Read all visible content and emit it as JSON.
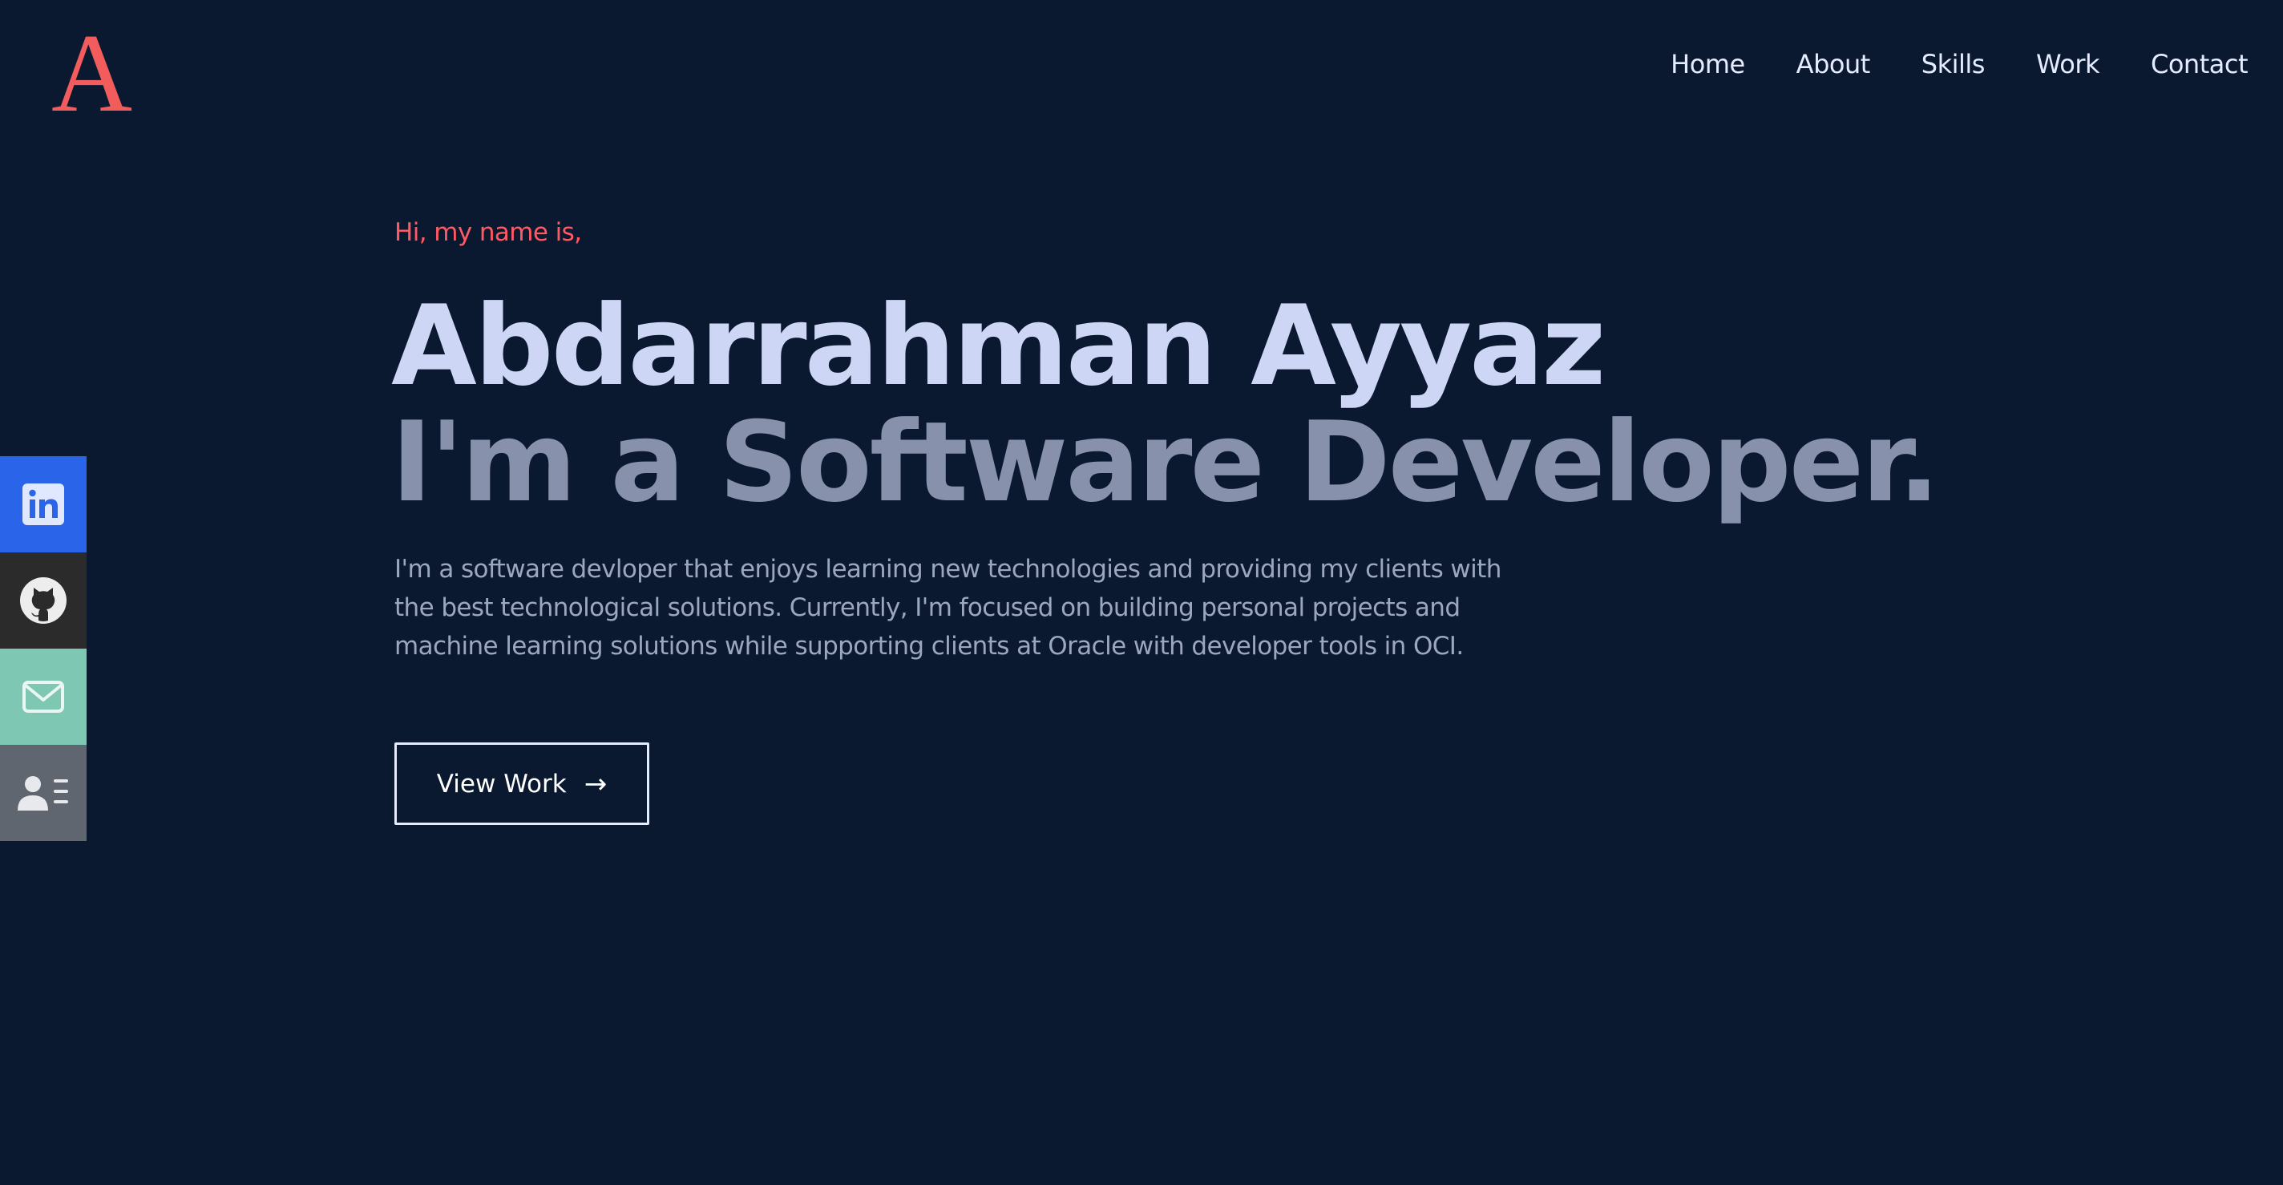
{
  "logo": {
    "text": "A"
  },
  "nav": {
    "items": [
      {
        "label": "Home"
      },
      {
        "label": "About"
      },
      {
        "label": "Skills"
      },
      {
        "label": "Work"
      },
      {
        "label": "Contact"
      }
    ]
  },
  "hero": {
    "greeting": "Hi, my name is,",
    "name": "Abdarrahman Ayyaz",
    "role": "I'm a Software Developer.",
    "description": "I'm a software devloper that enjoys learning new technologies and providing my clients with the best technological solutions. Currently, I'm focused on building personal projects and machine learning solutions while supporting clients at Oracle with developer tools in OCI.",
    "cta_label": "View Work",
    "cta_icon": "arrow-right-icon"
  },
  "social": {
    "items": [
      {
        "icon": "linkedin-icon",
        "color": "#2a64e8"
      },
      {
        "icon": "github-icon",
        "color": "#2b2b2b"
      },
      {
        "icon": "mail-icon",
        "color": "#7dc7b3"
      },
      {
        "icon": "contact-card-icon",
        "color": "#5f6670"
      }
    ]
  },
  "colors": {
    "background": "#0b1930",
    "accent": "#f25c5c",
    "name": "#cdd6f5",
    "role": "#8891ab",
    "text": "#9da6bf"
  }
}
